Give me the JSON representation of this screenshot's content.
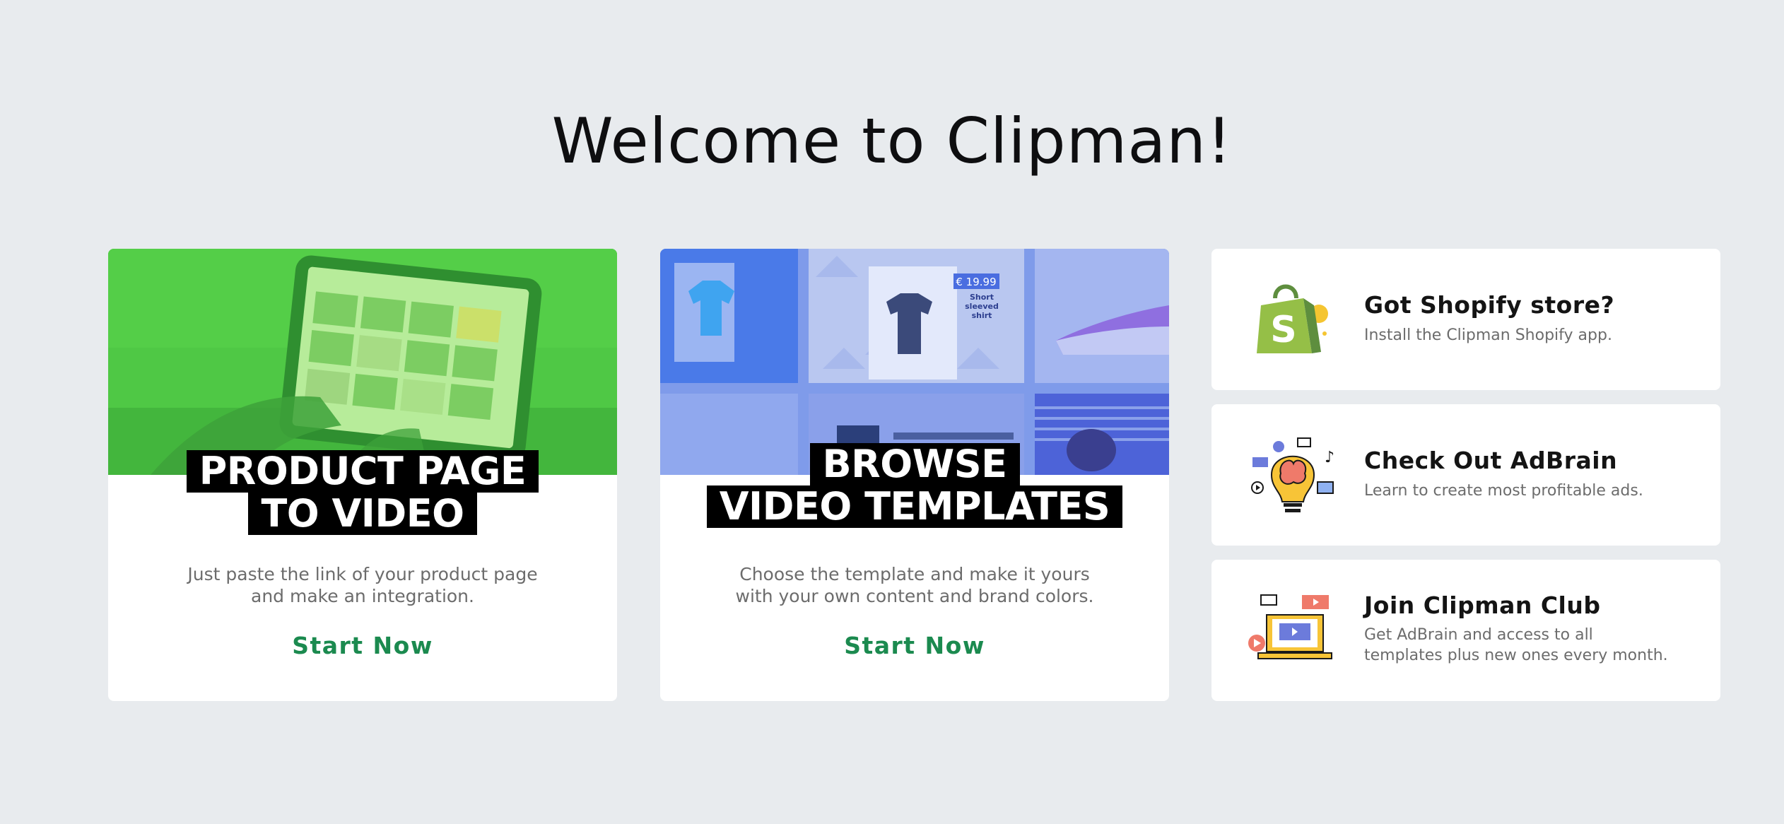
{
  "page": {
    "title": "Welcome to Clipman!"
  },
  "cards": [
    {
      "banner_line1": "PRODUCT PAGE",
      "banner_line2": "TO VIDEO",
      "desc_line1": "Just paste the link of your product page",
      "desc_line2": "and make an integration.",
      "cta": "Start Now"
    },
    {
      "banner_line1": "BROWSE",
      "banner_line2": "VIDEO TEMPLATES",
      "desc_line1": "Choose the template and make it yours",
      "desc_line2": "with your own content and brand colors.",
      "cta": "Start Now",
      "thumbs": {
        "price": "€ 19.99",
        "shirt_label_1": "Short",
        "shirt_label_2": "sleeved",
        "shirt_label_3": "shirt"
      }
    }
  ],
  "side_cards": [
    {
      "title": "Got Shopify store?",
      "sub1": "Install the Clipman Shopify app.",
      "sub2": "",
      "icon": "shopify-bag-icon"
    },
    {
      "title": "Check Out AdBrain",
      "sub1": "Learn to create most profitable ads.",
      "sub2": "",
      "icon": "brain-bulb-icon"
    },
    {
      "title": "Join Clipman Club",
      "sub1": "Get AdBrain and access to all",
      "sub2": "templates plus new ones every month.",
      "icon": "laptop-video-icon"
    }
  ],
  "colors": {
    "background": "#e8ebee",
    "cta": "#1b8a4f",
    "hero_green": "#4cc744",
    "hero_blue": "#7f9bea"
  }
}
